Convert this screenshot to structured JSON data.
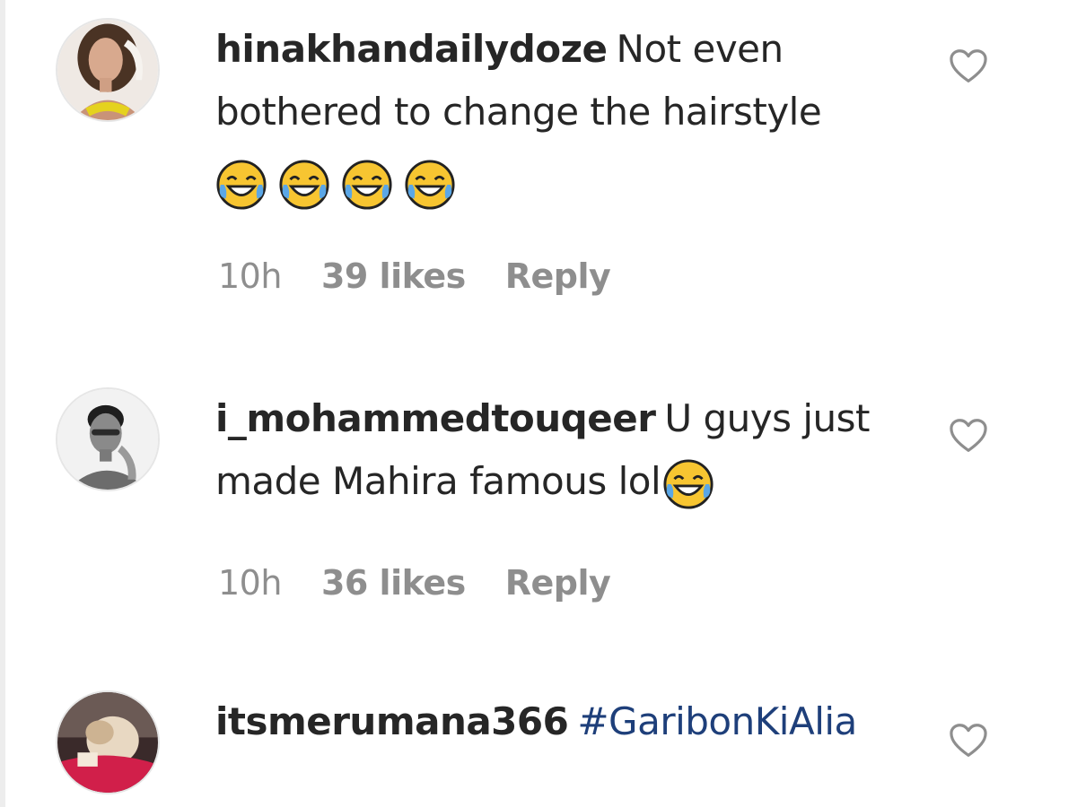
{
  "comments": [
    {
      "username": "hinakhandailydoze",
      "text": "Not even bothered to change the hairstyle",
      "emojis": [
        "face-with-tears-of-joy-icon",
        "face-with-tears-of-joy-icon",
        "face-with-tears-of-joy-icon",
        "face-with-tears-of-joy-icon"
      ],
      "time": "10h",
      "likes": "39 likes",
      "reply": "Reply"
    },
    {
      "username": "i_mohammedtouqeer",
      "text": "U guys just made Mahira famous lol",
      "emojis": [
        "face-with-tears-of-joy-icon"
      ],
      "time": "10h",
      "likes": "36 likes",
      "reply": "Reply"
    },
    {
      "username": "itsmerumana366",
      "hashtag": "#GaribonKiAlia"
    }
  ],
  "colors": {
    "text": "#262626",
    "meta": "#8e8e8e",
    "hashtag": "#1e3f7a"
  }
}
